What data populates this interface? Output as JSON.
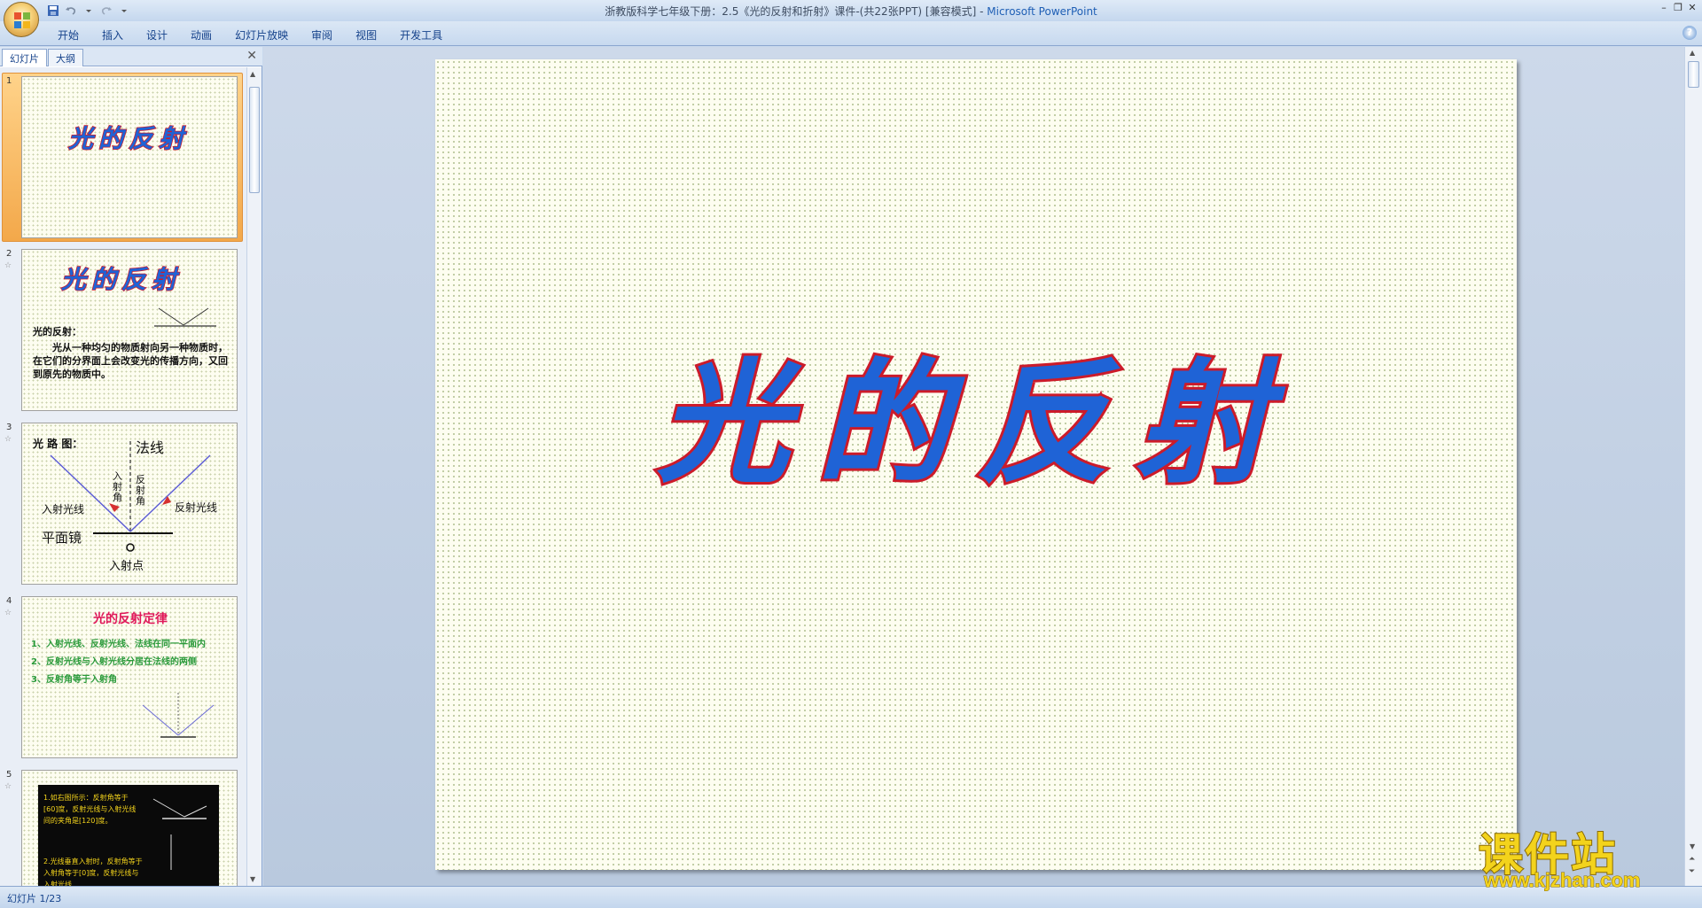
{
  "window": {
    "title_prefix": "浙教版科学七年级下册：2.5《光的反射和折射》课件-(共22张PPT) [兼容模式] - ",
    "title_app": "Microsoft PowerPoint"
  },
  "ribbon": {
    "tabs": [
      "开始",
      "插入",
      "设计",
      "动画",
      "幻灯片放映",
      "审阅",
      "视图",
      "开发工具"
    ],
    "help": "?"
  },
  "left_pane": {
    "tabs": [
      "幻灯片",
      "大纲"
    ],
    "close": "✕",
    "thumbnails": [
      {
        "num": "1",
        "title": "光的反射"
      },
      {
        "num": "2",
        "title": "光的反射",
        "heading": "光的反射：",
        "body": "光从一种均匀的物质射向另一种物质时，在它们的分界面上会改变光的传播方向，又回到原先的物质中。"
      },
      {
        "num": "3",
        "labels": {
          "diagram": "光 路 图：",
          "normal": "法线",
          "incident_angle": "入射角",
          "reflect_angle": "反射角",
          "incident_ray": "入射光线",
          "reflect_ray": "反射光线",
          "mirror": "平面镜",
          "point": "入射点",
          "o": "O"
        }
      },
      {
        "num": "4",
        "title": "光的反射定律",
        "lines": [
          "1、入射光线、反射光线、法线在同一平面内",
          "2、反射光线与入射光线分居在法线的两侧",
          "3、反射角等于入射角"
        ]
      },
      {
        "num": "5",
        "lines": [
          "1.如右图所示：反射角等于[60]度，反射光线与入射光线间的夹角是[120]度。",
          "2.光线垂直入射时，反射角等于入射角等于[0]度，反射光线与入射光线"
        ]
      }
    ]
  },
  "slide": {
    "title": "光的反射"
  },
  "status": {
    "text": "幻灯片 1/23"
  },
  "watermark": {
    "name": "课件站",
    "url": "www.kjzhan.com"
  }
}
